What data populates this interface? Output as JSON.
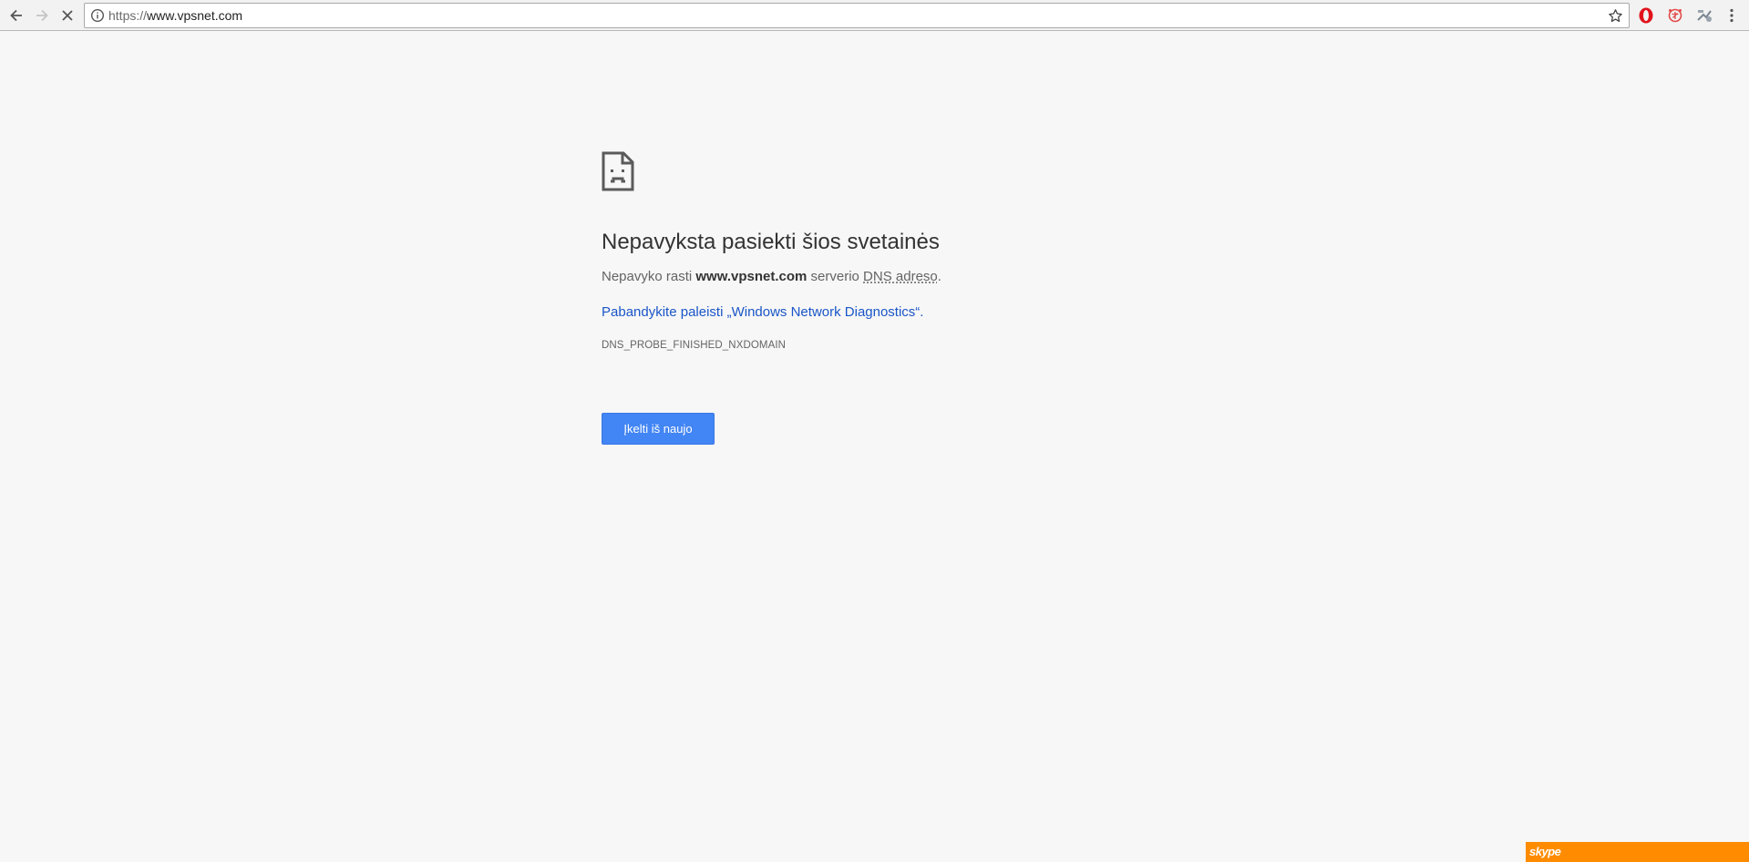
{
  "browser": {
    "url_scheme": "https://",
    "url_host": "www.vpsnet.com",
    "icons": {
      "back": "arrow-left-icon",
      "forward": "arrow-right-icon",
      "stop": "close-icon",
      "site_info": "info-icon",
      "bookmark": "star-icon",
      "opera_extension": "opera-icon",
      "extension_2": "red-extension-icon",
      "extension_3": "gray-extension-icon",
      "menu": "kebab-menu-icon"
    }
  },
  "error_page": {
    "icon": "sad-page-icon",
    "heading": "Nepavyksta pasiekti šios svetainės",
    "summary_prefix": "Nepavyko rasti ",
    "summary_host": "www.vpsnet.com",
    "summary_middle": " serverio ",
    "summary_abbr": "DNS adreso",
    "summary_suffix": ".",
    "suggestion": "Pabandykite paleisti „Windows Network Diagnostics“.",
    "error_code": "DNS_PROBE_FINISHED_NXDOMAIN",
    "reload_label": "Įkelti iš naujo"
  },
  "skype": {
    "logo_text": "skype",
    "bar_color": "#ff8c00"
  },
  "colors": {
    "page_background": "#f7f7f7",
    "link": "#1a56c7",
    "button": "#4285f4"
  }
}
